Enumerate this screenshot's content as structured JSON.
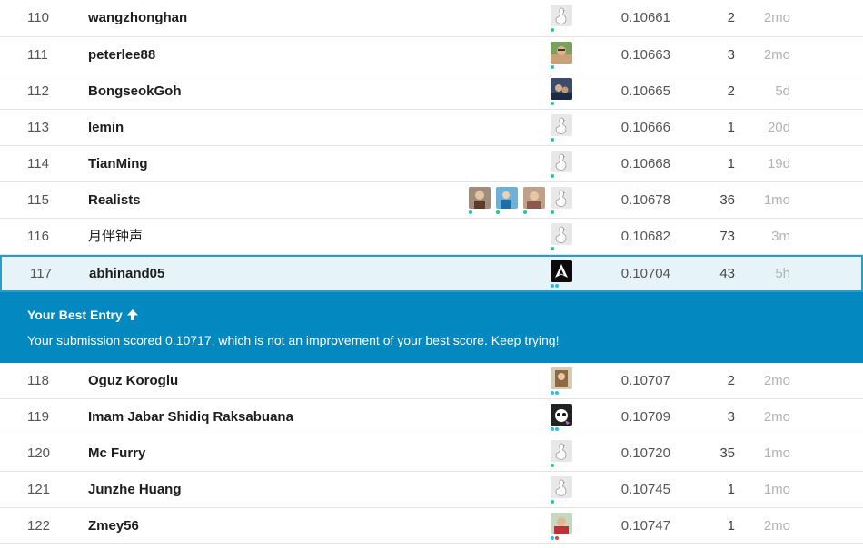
{
  "leaderboard": {
    "rows_above": [
      {
        "rank": "110",
        "name": "wangzhonghan",
        "score": "0.10661",
        "entries": "2",
        "last": "2mo"
      },
      {
        "rank": "111",
        "name": "peterlee88",
        "score": "0.10663",
        "entries": "3",
        "last": "2mo"
      },
      {
        "rank": "112",
        "name": "BongseokGoh",
        "score": "0.10665",
        "entries": "2",
        "last": "5d"
      },
      {
        "rank": "113",
        "name": "lemin",
        "score": "0.10666",
        "entries": "1",
        "last": "20d"
      },
      {
        "rank": "114",
        "name": "TianMing",
        "score": "0.10668",
        "entries": "1",
        "last": "19d"
      },
      {
        "rank": "115",
        "name": "Realists",
        "score": "0.10678",
        "entries": "36",
        "last": "1mo"
      },
      {
        "rank": "116",
        "name": "月伴钟声",
        "score": "0.10682",
        "entries": "73",
        "last": "3m"
      }
    ],
    "current": {
      "rank": "117",
      "name": "abhinand05",
      "score": "0.10704",
      "entries": "43",
      "last": "5h"
    },
    "rows_below": [
      {
        "rank": "118",
        "name": "Oguz Koroglu",
        "score": "0.10707",
        "entries": "2",
        "last": "2mo"
      },
      {
        "rank": "119",
        "name": "Imam Jabar Shidiq Raksabuana",
        "score": "0.10709",
        "entries": "3",
        "last": "2mo"
      },
      {
        "rank": "120",
        "name": "Mc Furry",
        "score": "0.10720",
        "entries": "35",
        "last": "1mo"
      },
      {
        "rank": "121",
        "name": "Junzhe Huang",
        "score": "0.10745",
        "entries": "1",
        "last": "1mo"
      },
      {
        "rank": "122",
        "name": "Zmey56",
        "score": "0.10747",
        "entries": "1",
        "last": "2mo"
      }
    ]
  },
  "banner": {
    "title": "Your Best Entry",
    "icon": "arrow-up-icon",
    "message": "Your submission scored 0.10717, which is not an improvement of your best score. Keep trying!"
  },
  "colors": {
    "banner_bg": "#0388bf",
    "highlight_bg": "#e6f4f9",
    "highlight_border": "#2d9bc6",
    "tier_dot": "#20beff",
    "tier_dot_green": "#20c997"
  }
}
